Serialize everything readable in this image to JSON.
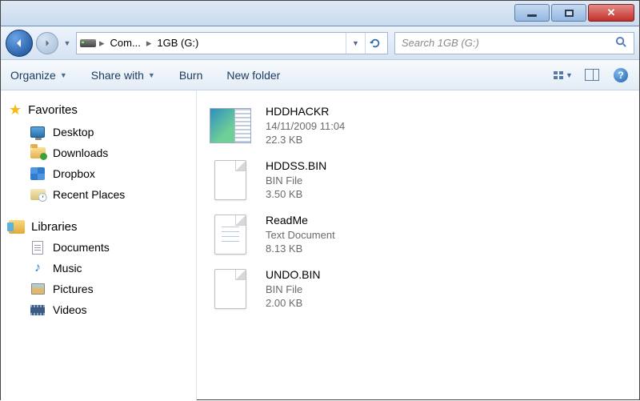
{
  "breadcrumb": {
    "item1": "Com...",
    "item2": "1GB (G:)"
  },
  "search": {
    "placeholder": "Search 1GB (G:)"
  },
  "toolbar": {
    "organize": "Organize",
    "share": "Share with",
    "burn": "Burn",
    "newfolder": "New folder"
  },
  "sidebar": {
    "favorites": {
      "label": "Favorites",
      "items": [
        "Desktop",
        "Downloads",
        "Dropbox",
        "Recent Places"
      ]
    },
    "libraries": {
      "label": "Libraries",
      "items": [
        "Documents",
        "Music",
        "Pictures",
        "Videos"
      ]
    }
  },
  "files": [
    {
      "name": "HDDHACKR",
      "line2": "14/11/2009 11:04",
      "line3": "22.3 KB",
      "icon": "app"
    },
    {
      "name": "HDDSS.BIN",
      "line2": "BIN File",
      "line3": "3.50 KB",
      "icon": "bin"
    },
    {
      "name": "ReadMe",
      "line2": "Text Document",
      "line3": "8.13 KB",
      "icon": "txt"
    },
    {
      "name": "UNDO.BIN",
      "line2": "BIN File",
      "line3": "2.00 KB",
      "icon": "bin"
    }
  ]
}
